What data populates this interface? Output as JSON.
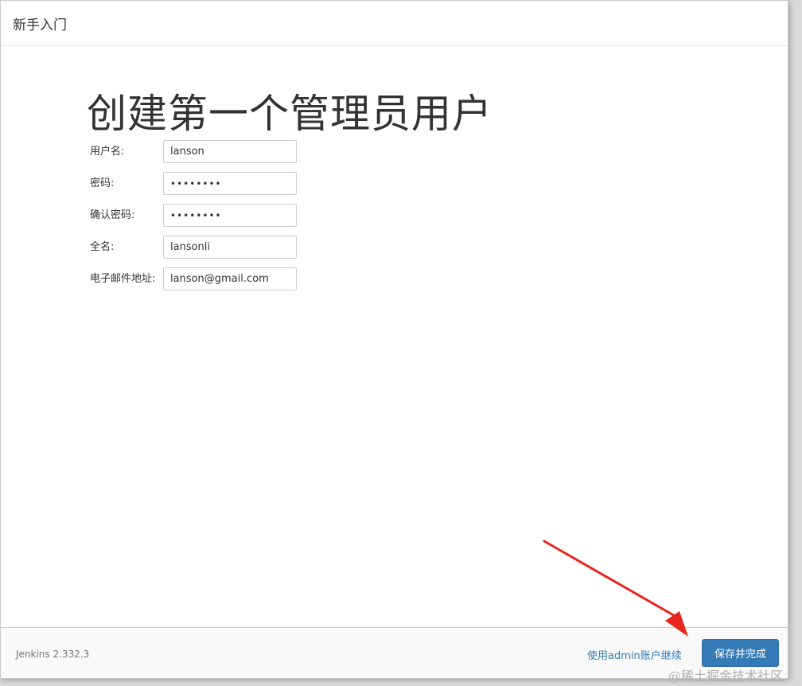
{
  "header": {
    "title": "新手入门"
  },
  "main": {
    "heading": "创建第一个管理员用户",
    "fields": [
      {
        "label": "用户名:",
        "value": "lanson",
        "type": "text"
      },
      {
        "label": "密码:",
        "value": "••••••••",
        "type": "password"
      },
      {
        "label": "确认密码:",
        "value": "••••••••",
        "type": "password"
      },
      {
        "label": "全名:",
        "value": "lansonli",
        "type": "text"
      },
      {
        "label": "电子邮件地址:",
        "value": "lanson@gmail.com",
        "type": "text"
      }
    ]
  },
  "footer": {
    "version": "Jenkins 2.332.3",
    "skip_link": "使用admin账户继续",
    "save_button": "保存并完成"
  },
  "watermark": "@稀土掘金技术社区",
  "colors": {
    "primary": "#337ab7",
    "annotation_arrow": "#e8261f"
  }
}
